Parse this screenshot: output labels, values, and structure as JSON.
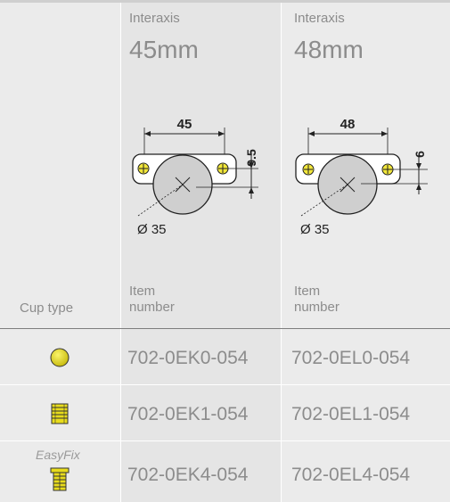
{
  "header": {
    "col1": {
      "label": "Interaxis",
      "value": "45mm"
    },
    "col2": {
      "label": "Interaxis",
      "value": "48mm"
    }
  },
  "diagrams": {
    "d1": {
      "width": "45",
      "offset": "9.5",
      "diameter": "Ø 35"
    },
    "d2": {
      "width": "48",
      "offset": "6",
      "diameter": "Ø 35"
    }
  },
  "subheader": {
    "cup_type": "Cup type",
    "item_number_1": "Item\nnumber",
    "item_number_2": "Item\nnumber"
  },
  "rows": [
    {
      "icon": "round-cup-icon",
      "label": "",
      "col1": "702-0EK0-054",
      "col2": "702-0EL0-054"
    },
    {
      "icon": "dowel-cup-icon",
      "label": "",
      "col1": "702-0EK1-054",
      "col2": "702-0EL1-054"
    },
    {
      "icon": "easyfix-cup-icon",
      "label": "EasyFix",
      "col1": "702-0EK4-054",
      "col2": "702-0EL4-054"
    }
  ],
  "colors": {
    "icon_yellow": "#e8dc1c",
    "text_grey": "#8c8c8c",
    "background": "#ebebeb"
  }
}
